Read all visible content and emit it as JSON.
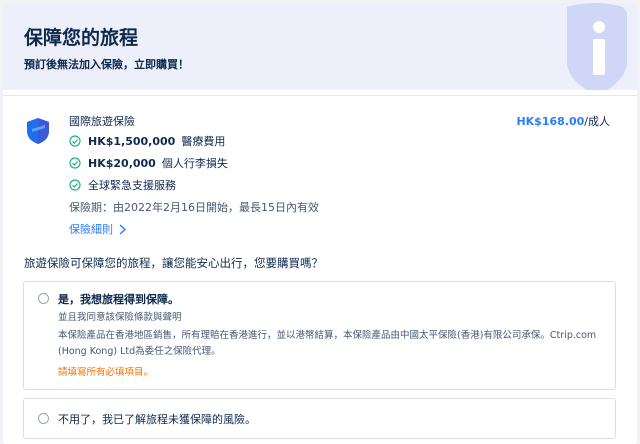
{
  "header": {
    "title": "保障您的旅程",
    "subtitle": "預訂後無法加入保險，立即購買！"
  },
  "plan": {
    "name": "國際旅遊保險",
    "price": "HK$168.00",
    "price_unit": "/成人",
    "benefits": [
      {
        "amount": "HK$1,500,000",
        "label": "醫療費用"
      },
      {
        "amount": "HK$20,000",
        "label": "個人行李損失"
      },
      {
        "amount": "",
        "label": "全球緊急支援服務"
      }
    ],
    "period": "保險期：由2022年2月16日開始，最長15日內有效",
    "details_link": "保險細則"
  },
  "question": "旅遊保險可保障您的旅程，讓您能安心出行，您要購買嗎？",
  "options": {
    "yes": {
      "title": "是，我想旅程得到保障。",
      "agree": "並且我同意該保險條款與聲明",
      "disclaimer": "本保險產品在香港地區銷售，所有理賠在香港進行，並以港幣結算，本保險產品由中國太平保險(香港)有限公司承保。Ctrip.com (Hong Kong) Ltd為委任之保險代理。",
      "warning": "請填寫所有必填項目。"
    },
    "no": {
      "title": "不用了，我已了解旅程未獲保障的風險。"
    }
  },
  "colors": {
    "accent": "#287dfa",
    "warning": "#ff6f00",
    "header_bg": "#edf0fb",
    "text": "#0f294d",
    "check": "#22b07d"
  }
}
